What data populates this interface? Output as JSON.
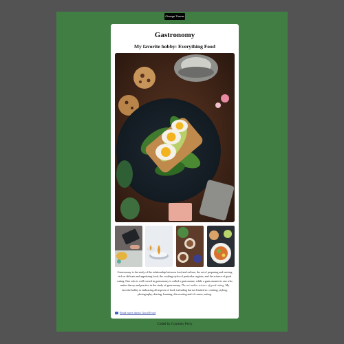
{
  "controls": {
    "theme_button": "Change Theme"
  },
  "card": {
    "title": "Gastronomy",
    "subtitle": "My favorite hobby: Everything Food",
    "paragraph_main": "Gastronomy is the study of the relationship between food and culture, the art of preparing and serving rich or delicate and appetizing food, the cooking styles of particular regions, and the science of good eating. One who is well versed in gastronomy is called a gastronome, while a gastronomist is one who unites theory and practice in the study of gastronomy.",
    "paragraph_italic": "The art and/or science of good eating.",
    "paragraph_tail": "My favorite hobby is embracing all aspects of food, including but not limited to: cooking, styling, photography, sharing, learning, discovering and of course, eating.",
    "read_more": "Read more about Good Food"
  },
  "footer": {
    "text": "Coded by Courtney Perry"
  },
  "colors": {
    "page_bg": "#535353",
    "green_panel": "#417e44",
    "card_bg": "#ffffff",
    "button_bg": "#050505",
    "link": "#3a4aa8"
  }
}
